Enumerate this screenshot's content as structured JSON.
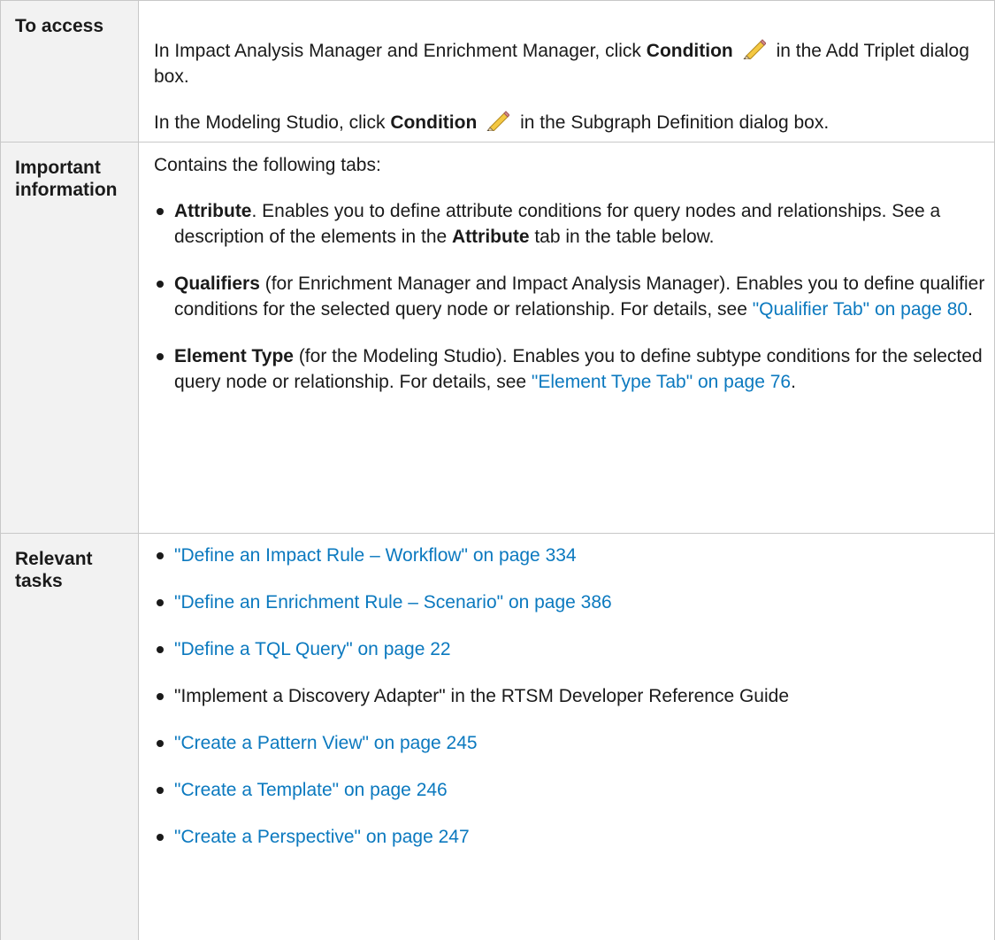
{
  "colors": {
    "link": "#0b79bf",
    "text": "#1a1a1a",
    "header_bg": "#f2f2f2",
    "border": "#c8c8c8"
  },
  "rows": {
    "access": {
      "label": "To access",
      "p1": {
        "pre": "In Impact Analysis Manager and Enrichment Manager, click ",
        "bold": "Condition",
        "icon": "pencil-icon",
        "post": " in the Add Triplet dialog box."
      },
      "p2": {
        "pre": "In the Modeling Studio, click ",
        "bold": "Condition",
        "icon": "pencil-icon",
        "post": " in the Subgraph Definition dialog box."
      }
    },
    "important": {
      "label": "Important information",
      "intro": "Contains the following tabs:",
      "items": [
        {
          "bold": "Attribute",
          "text1": ". Enables you to define attribute conditions for query nodes and relationships. See a description of the elements in the ",
          "bold2": "Attribute",
          "text2": " tab in the table below."
        },
        {
          "bold": "Qualifiers",
          "text1": " (for Enrichment Manager and Impact Analysis Manager). Enables you to define qualifier conditions for the selected query node or relationship. For details, see ",
          "link": "\"Qualifier Tab\" on page 80",
          "text2": "."
        },
        {
          "bold": "Element Type",
          "text1": " (for the Modeling Studio). Enables you to define subtype conditions for the selected query node or relationship. For details, see ",
          "link": "\"Element Type Tab\" on page 76",
          "text2": "."
        }
      ]
    },
    "tasks": {
      "label": "Relevant tasks",
      "items": [
        {
          "text": "\"Define an Impact Rule – Workflow\" on page 334",
          "is_link": true
        },
        {
          "text": "\"Define an Enrichment Rule – Scenario\" on page 386",
          "is_link": true
        },
        {
          "text": "\"Define a TQL Query\" on page 22",
          "is_link": true
        },
        {
          "text": "\"Implement a Discovery Adapter\" in the RTSM Developer Reference Guide",
          "is_link": false
        },
        {
          "text": "\"Create a Pattern View\" on page 245",
          "is_link": true
        },
        {
          "text": "\"Create a Template\" on page 246",
          "is_link": true
        },
        {
          "text": "\"Create a Perspective\" on page 247",
          "is_link": true
        }
      ]
    }
  }
}
